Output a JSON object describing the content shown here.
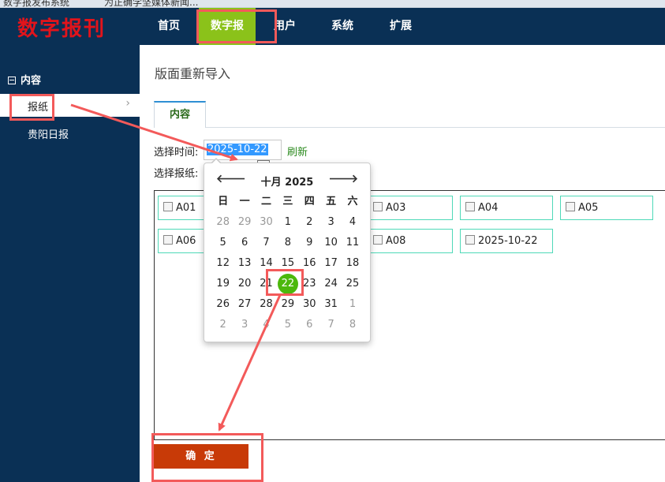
{
  "browser": {
    "tab1": "数字报发布系统",
    "tab2": "为正确学坚媒体新闻..."
  },
  "header": {
    "logo": "数字报刊",
    "nav": [
      "首页",
      "数字报",
      "用户",
      "系统",
      "扩展"
    ],
    "active_index": 1
  },
  "sidebar": {
    "section": "内容",
    "items": [
      "报纸",
      "贵阳日报"
    ],
    "chevron": "›"
  },
  "main": {
    "page_title": "版面重新导入",
    "tab": "内容",
    "date_label": "选择时间:",
    "date_value": "2025-10-22",
    "refresh": "刷新",
    "paper_label": "选择报纸:",
    "checkboxes": [
      "A01",
      "A03",
      "A04",
      "A05",
      "A06",
      "A08",
      "2025-10-22"
    ],
    "confirm": "确 定"
  },
  "calendar": {
    "title": "十月 2025",
    "prev": "🡐",
    "next": "🡒",
    "weekdays": [
      "日",
      "一",
      "二",
      "三",
      "四",
      "五",
      "六"
    ],
    "weeks": [
      [
        "28",
        "29",
        "30",
        "1",
        "2",
        "3",
        "4"
      ],
      [
        "5",
        "6",
        "7",
        "8",
        "9",
        "10",
        "11"
      ],
      [
        "12",
        "13",
        "14",
        "15",
        "16",
        "17",
        "18"
      ],
      [
        "19",
        "20",
        "21",
        "22",
        "23",
        "24",
        "25"
      ],
      [
        "26",
        "27",
        "28",
        "29",
        "30",
        "31",
        "1"
      ],
      [
        "2",
        "3",
        "4",
        "5",
        "6",
        "7",
        "8"
      ]
    ],
    "selected": "22"
  },
  "colors": {
    "header_bg": "#0a3055",
    "nav_active": "#8bc21a",
    "logo": "#e2141b",
    "button": "#c83a07",
    "selected_day": "#4cb80c",
    "annotation": "#f35a5a",
    "checkbox_border": "#4fd9b8"
  }
}
